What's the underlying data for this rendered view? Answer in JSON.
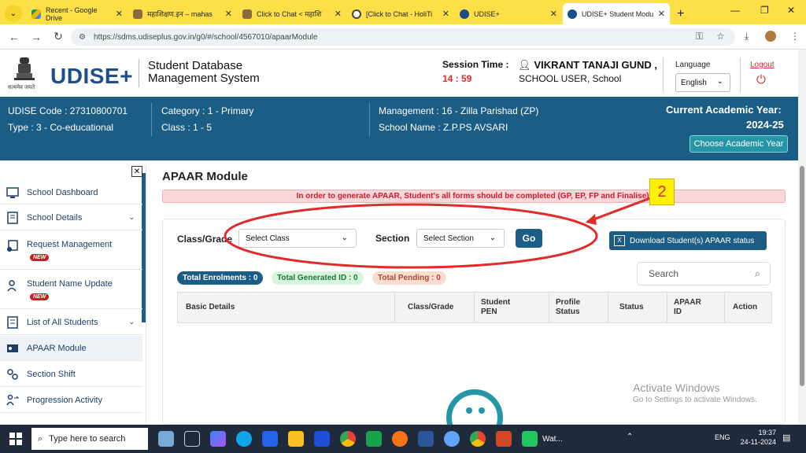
{
  "browser": {
    "tabs": [
      {
        "label": "Recent - Google Drive",
        "icon": "google-drive-icon",
        "color": "#f4b400"
      },
      {
        "label": "महाशिक्षण.इन – mahas",
        "icon": "site-favicon-icon",
        "color": "#6b4e2e"
      },
      {
        "label": "Click to Chat < महाशि",
        "icon": "site-favicon-icon",
        "color": "#6b4e2e"
      },
      {
        "label": "[Click to Chat - HoliTi",
        "icon": "wordpress-icon",
        "color": "#444"
      },
      {
        "label": "UDISE+",
        "icon": "udise-icon",
        "color": "#1d4e89"
      },
      {
        "label": "UDISE+ Student Modu",
        "icon": "udise-icon",
        "color": "#1d4e89"
      }
    ],
    "url": "https://sdms.udiseplus.gov.in/g0/#/school/4567010/apaarModule"
  },
  "header": {
    "brand": "UDISE+",
    "system_name_line1": "Student Database",
    "system_name_line2": "Management System",
    "session_label": "Session Time :",
    "session_time": "14 : 59",
    "user_name": "VIKRANT TANAJI GUND ,",
    "user_role": "SCHOOL USER,   School",
    "language_label": "Language",
    "language_value": "English",
    "logout": "Logout",
    "emblem_caption": "सत्यमेव जयते"
  },
  "school_info": {
    "udise_code": "UDISE Code : 27310800701",
    "type": "Type : 3 - Co-educational",
    "category": "Category : 1 - Primary",
    "class": "Class : 1 - 5",
    "management": "Management : 16 - Zilla Parishad (ZP)",
    "school_name": "School Name : Z.P.PS AVSARI",
    "academic_year_label": "Current Academic Year:",
    "academic_year": "2024-25",
    "choose_year_button": "Choose Academic Year"
  },
  "sidebar": {
    "items": [
      {
        "label": "School Dashboard",
        "icon": "dashboard-icon"
      },
      {
        "label": "School Details",
        "icon": "document-icon"
      },
      {
        "label": "Request Management",
        "icon": "request-icon"
      },
      {
        "label": "Student Name Update",
        "icon": "user-edit-icon"
      },
      {
        "label": "List of All Students",
        "icon": "list-icon"
      },
      {
        "label": "APAAR Module",
        "icon": "id-card-icon"
      },
      {
        "label": "Section Shift",
        "icon": "shift-icon"
      },
      {
        "label": "Progression Activity",
        "icon": "progression-icon"
      }
    ],
    "new_badge": "NEW"
  },
  "main": {
    "title": "APAAR Module",
    "alert": "In order to generate APAAR, Student's all forms should be completed (GP, EP, FP and Finalise).",
    "class_label": "Class/Grade",
    "class_select": "Select Class",
    "section_label": "Section",
    "section_select": "Select Section",
    "go_button": "Go",
    "download_button": "Download Student(s) APAAR status",
    "total_enrolments": "Total Enrolments : 0",
    "total_generated": "Total Generated ID : 0",
    "total_pending": "Total Pending : 0",
    "search_placeholder": "Search",
    "columns": [
      "Basic Details",
      "Class/Grade",
      "Student PEN",
      "Profile Status",
      "Status",
      "APAAR ID",
      "Action"
    ]
  },
  "annotation": {
    "number": "2",
    "highlight_color": "#e02b2b"
  },
  "watermark": {
    "line1": "Activate Windows",
    "line2": "Go to Settings to activate Windows."
  },
  "taskbar": {
    "search_placeholder": "Type here to search",
    "lang": "ENG",
    "time": "19:37",
    "date": "24-11-2024",
    "whatsapp_label": "Wat..."
  },
  "colors": {
    "primary": "#1b5d85",
    "accent": "#2596a6",
    "danger": "#e02b2b",
    "tab_bar": "#fde047"
  }
}
